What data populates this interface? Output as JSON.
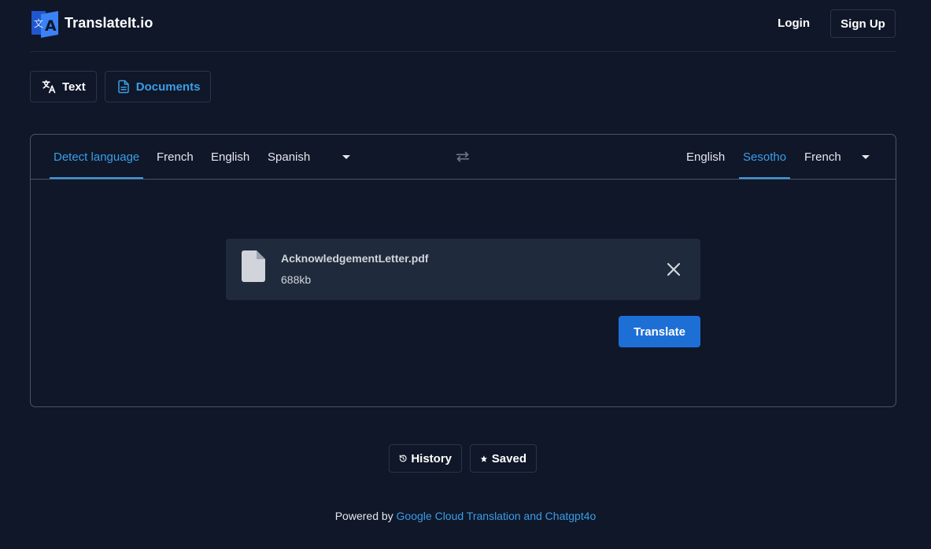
{
  "header": {
    "brand": "TranslateIt.io",
    "login_label": "Login",
    "signup_label": "Sign Up"
  },
  "mode_tabs": [
    {
      "label": "Text",
      "icon": "translate-icon",
      "active": false
    },
    {
      "label": "Documents",
      "icon": "document-icon",
      "active": true
    }
  ],
  "source_languages": [
    {
      "label": "Detect language",
      "active": true
    },
    {
      "label": "French",
      "active": false
    },
    {
      "label": "English",
      "active": false
    },
    {
      "label": "Spanish",
      "active": false
    }
  ],
  "target_languages": [
    {
      "label": "English",
      "active": false
    },
    {
      "label": "Sesotho",
      "active": true
    },
    {
      "label": "French",
      "active": false
    }
  ],
  "file": {
    "name": "AcknowledgementLetter.pdf",
    "size": "688kb"
  },
  "translate_label": "Translate",
  "bottom": {
    "history_label": "History",
    "saved_label": "Saved"
  },
  "footer": {
    "prefix": "Powered by",
    "link": "Google Cloud Translation and Chatgpt4o"
  },
  "colors": {
    "background": "#0f1729",
    "accent": "#3b9ee6",
    "primary_button": "#1d6fd6",
    "card": "#1f2a3c"
  }
}
